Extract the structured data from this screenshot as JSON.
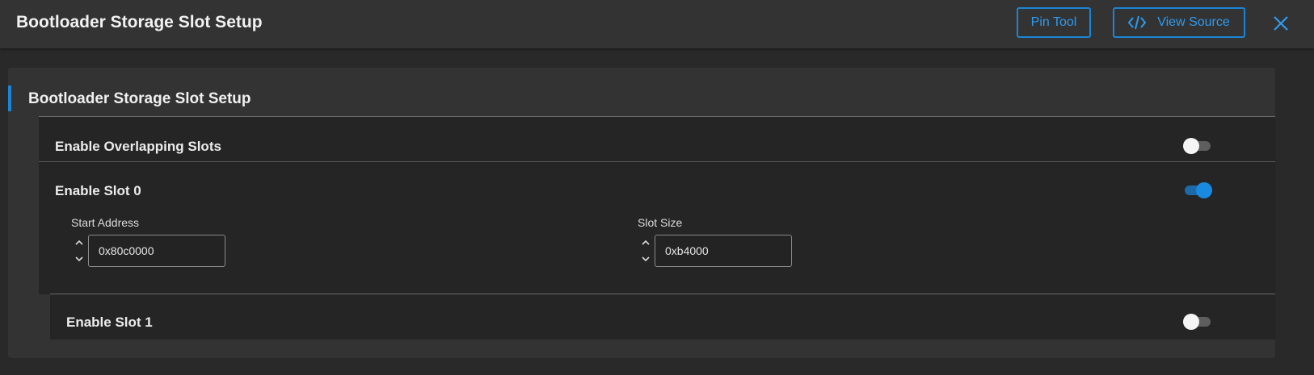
{
  "header": {
    "title": "Bootloader Storage Slot Setup",
    "pin_tool_label": "Pin Tool",
    "view_source_label": "View Source"
  },
  "panel": {
    "title": "Bootloader Storage Slot Setup",
    "overlap": {
      "label": "Enable Overlapping Slots",
      "enabled": false
    },
    "slot0": {
      "label": "Enable Slot 0",
      "enabled": true,
      "start_address_label": "Start Address",
      "start_address_value": "0x80c0000",
      "slot_size_label": "Slot Size",
      "slot_size_value": "0xb4000"
    },
    "slot1": {
      "label": "Enable Slot 1",
      "enabled": false
    }
  },
  "colors": {
    "accent": "#1a85d6",
    "background": "#292929",
    "surface": "#333333",
    "group": "#252525"
  }
}
